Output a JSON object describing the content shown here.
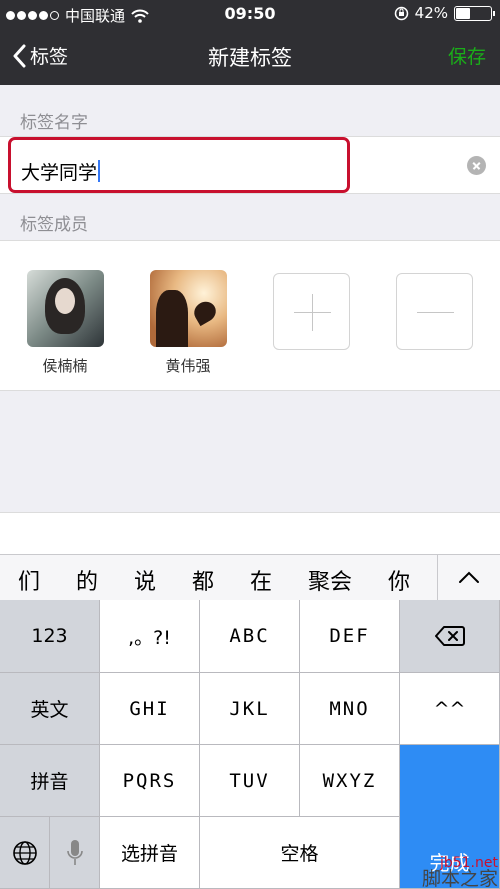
{
  "status_bar": {
    "carrier": "中国联通",
    "time": "09:50",
    "battery_text": "42%",
    "battery_level": 0.42
  },
  "nav": {
    "back_label": "标签",
    "title": "新建标签",
    "save_label": "保存"
  },
  "tag_name": {
    "section_label": "标签名字",
    "value": "大学同学"
  },
  "members": {
    "section_label": "标签成员",
    "people": [
      {
        "name": "侯楠楠"
      },
      {
        "name": "黄伟强"
      }
    ]
  },
  "keyboard": {
    "candidates": [
      "们",
      "的",
      "说",
      "都",
      "在",
      "聚会",
      "你"
    ],
    "rows": {
      "row1": [
        "123",
        ",。?!",
        "ABC",
        "DEF"
      ],
      "row2": [
        "英文",
        "GHI",
        "JKL",
        "MNO",
        "^^"
      ],
      "row3": [
        "拼音",
        "PQRS",
        "TUV",
        "WXYZ"
      ],
      "row4": [
        "选拼音",
        "空格"
      ]
    },
    "done_label": "完成"
  },
  "watermark": {
    "domain": "jb51.net",
    "text": "脚本之家"
  },
  "colors": {
    "nav_bg": "#2f2f33",
    "accent_green": "#1aad19",
    "highlight_red": "#c8102e",
    "done_blue": "#2e8cf4"
  }
}
